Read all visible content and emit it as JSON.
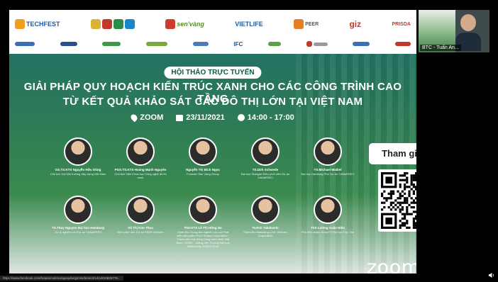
{
  "logos_row1": [
    "TECHFEST",
    "sen'vàng",
    "VIETLIFE",
    "PEER",
    "giz",
    "PRISDA"
  ],
  "logos_row2": [
    "IFC"
  ],
  "badge": "HỘI THẢO TRỰC TUYẾN",
  "title_line1": "GIẢI PHÁP QUY HOẠCH KIẾN TRÚC XANH CHO CÁC CÔNG TRÌNH CAO TẦNG",
  "title_line2": "TỪ KẾT QUẢ KHẢO SÁT CÁC ĐÔ THỊ LỚN TẠI VIỆT NAM",
  "info": {
    "place": "ZOOM",
    "date": "23/11/2021",
    "time": "14:00 - 17:00"
  },
  "speakers_row1": [
    {
      "name": "GS.TS.KTS Nguyễn Hữu Dũng",
      "role": "Chủ tịch Hội Môi trường Xây dựng Việt Nam"
    },
    {
      "name": "PGS.TS.KTS Hoàng Mạnh Nguyên",
      "role": "Chủ tịch Viện Khoa học Công nghệ đô thị xanh"
    },
    {
      "name": "Nguyễn Thị Bích Ngọc",
      "role": "Founder Sen Vàng Group"
    },
    {
      "name": "TS.Dirk Schwede",
      "role": "Đại học Stuttgart Điều phối viên Dự án CAMaRSEC"
    },
    {
      "name": "TS.Michael Waibel",
      "role": "Đại học Hamburg Phó Dự án CAMaRSEC"
    }
  ],
  "speakers_row2": [
    {
      "name": "TS.Thuy Nguyen Đại học Hamburg",
      "role": "Trợ lý nghiên cứu Dự án CAMaRSEC"
    },
    {
      "name": "Vũ Thị Kim Thoa",
      "role": "Điều phối viên Dự án PEER Vietnam"
    },
    {
      "name": "ThS.KTS Lê Thị Hồng Na",
      "role": "Giám đốc Trung tâm Nghiên cứu và Phát triển sản phẩm Phúc Khang Corporation · Thành viên Hội đồng Công trình xanh Việt Nam - VGBC · Giảng viên Trường Đại học Bách khoa, ĐHQG-HCM"
    },
    {
      "name": "Toshio Takahashi",
      "role": "Giám đốc Marketing LIXIL Vietnam Corporation"
    },
    {
      "name": "ThS Lương Xuân Hiếu",
      "role": "Phó chủ nhiệm Khoa KT Đại học Duy Tân"
    }
  ],
  "join_label": "Tham gia tại",
  "zoom_brand": "zoom",
  "video": {
    "name_tag": "BTC - Tuấn An..."
  },
  "status_url": "https://www.facebook.com/hoatacmoitruongxaydungvn/videos/421414610825778..."
}
